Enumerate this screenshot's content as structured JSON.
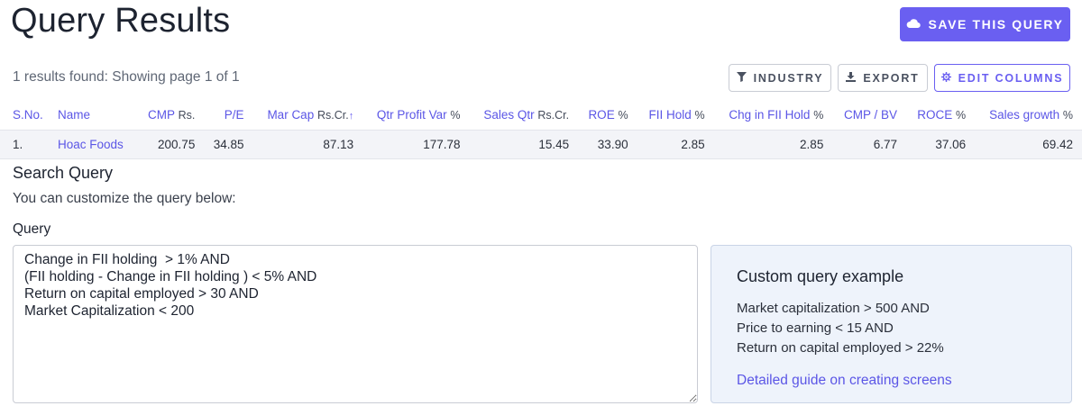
{
  "header": {
    "title": "Query Results",
    "save_button": "SAVE THIS QUERY"
  },
  "results_summary": "1 results found: Showing page 1 of 1",
  "toolbar": {
    "industry": "INDUSTRY",
    "export": "EXPORT",
    "edit_columns": "EDIT COLUMNS"
  },
  "table": {
    "columns": [
      {
        "label": "S.No.",
        "unit": ""
      },
      {
        "label": "Name",
        "unit": ""
      },
      {
        "label": "CMP",
        "unit": "Rs."
      },
      {
        "label": "P/E",
        "unit": ""
      },
      {
        "label": "Mar Cap",
        "unit": "Rs.Cr.",
        "sort": "↑"
      },
      {
        "label": "Qtr Profit Var",
        "unit": "%"
      },
      {
        "label": "Sales Qtr",
        "unit": "Rs.Cr."
      },
      {
        "label": "ROE",
        "unit": "%"
      },
      {
        "label": "FII Hold",
        "unit": "%"
      },
      {
        "label": "Chg in FII Hold",
        "unit": "%"
      },
      {
        "label": "CMP / BV",
        "unit": ""
      },
      {
        "label": "ROCE",
        "unit": "%"
      },
      {
        "label": "Sales growth",
        "unit": "%"
      }
    ],
    "rows": [
      [
        "1.",
        "Hoac Foods",
        "200.75",
        "34.85",
        "87.13",
        "177.78",
        "15.45",
        "33.90",
        "2.85",
        "2.85",
        "6.77",
        "37.06",
        "69.42"
      ]
    ]
  },
  "search": {
    "title": "Search Query",
    "subtitle": "You can customize the query below:",
    "query_label": "Query",
    "query_text": "Change in FII holding  > 1% AND\n(FII holding - Change in FII holding ) < 5% AND\nReturn on capital employed > 30 AND\nMarket Capitalization < 200"
  },
  "example": {
    "title": "Custom query example",
    "lines": [
      "Market capitalization > 500 AND",
      "Price to earning < 15 AND",
      "Return on capital employed > 22%"
    ],
    "link": "Detailed guide on creating screens"
  },
  "colors": {
    "accent": "#6a5ff1",
    "row_bg": "#f3f4f8",
    "example_bg": "#eef3fb"
  },
  "icons": {
    "save": "cloud-icon",
    "industry": "filter-icon",
    "export": "download-icon",
    "edit_columns": "gear-icon"
  }
}
